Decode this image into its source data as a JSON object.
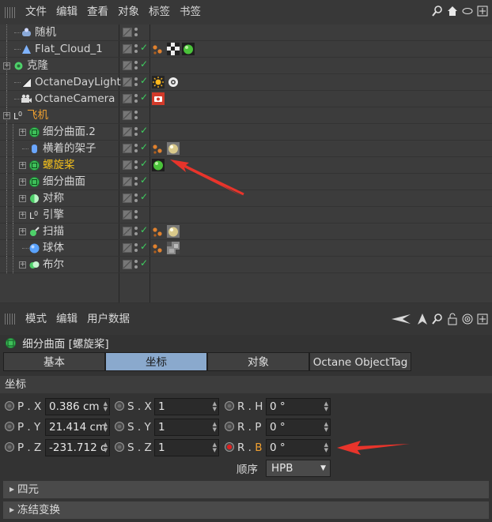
{
  "object_manager": {
    "menu": [
      "文件",
      "编辑",
      "查看",
      "对象",
      "标签",
      "书签"
    ],
    "top_icons": [
      "search-icon",
      "home-icon",
      "eye-icon",
      "add-icon"
    ],
    "rows": [
      {
        "label": "随机",
        "icon": "random-effector-icon",
        "indent": 1,
        "expand": false,
        "color": "normal",
        "tags": []
      },
      {
        "label": "Flat_Cloud_1",
        "icon": "cloud-icon",
        "indent": 1,
        "expand": false,
        "color": "normal",
        "tags": [
          "texture-dots-tag-icon",
          "checker-tag-icon",
          "green-material-tag-icon"
        ]
      },
      {
        "label": "克隆",
        "icon": "cloner-icon",
        "indent": 0,
        "expand": true,
        "color": "normal",
        "tags": []
      },
      {
        "label": "OctaneDayLight",
        "icon": "daylight-icon",
        "indent": 1,
        "expand": false,
        "color": "normal",
        "tags": [
          "sun-tag-icon",
          "gear-tag-icon"
        ]
      },
      {
        "label": "OctaneCamera",
        "icon": "camera-icon",
        "indent": 1,
        "expand": false,
        "color": "normal",
        "tags": [
          "camera-tag-icon"
        ]
      },
      {
        "label": "飞机",
        "icon": "null-object-icon",
        "indent": 0,
        "expand": true,
        "color": "orange",
        "tags": []
      },
      {
        "label": "细分曲面.2",
        "icon": "subdivision-icon",
        "indent": 2,
        "expand": true,
        "color": "normal",
        "tags": []
      },
      {
        "label": "横着的架子",
        "icon": "cylinder-icon",
        "indent": 2,
        "expand": false,
        "color": "normal",
        "tags": [
          "texture-dots-tag-icon",
          "sphere-material-tag-icon"
        ]
      },
      {
        "label": "螺旋桨",
        "icon": "subdivision-icon",
        "indent": 2,
        "expand": true,
        "color": "yellow",
        "tags": [
          "green-material-tag-icon"
        ]
      },
      {
        "label": "细分曲面",
        "icon": "subdivision-icon",
        "indent": 2,
        "expand": true,
        "color": "normal",
        "tags": []
      },
      {
        "label": "对称",
        "icon": "symmetry-icon",
        "indent": 2,
        "expand": true,
        "color": "normal",
        "tags": []
      },
      {
        "label": "引擎",
        "icon": "null-object-icon",
        "indent": 2,
        "expand": true,
        "color": "normal",
        "tags": []
      },
      {
        "label": "扫描",
        "icon": "sweep-icon",
        "indent": 2,
        "expand": true,
        "color": "normal",
        "tags": [
          "texture-dots-tag-icon",
          "sphere-material-tag-icon"
        ]
      },
      {
        "label": "球体",
        "icon": "sphere-icon",
        "indent": 2,
        "expand": false,
        "color": "normal",
        "tags": [
          "texture-dots-tag-icon",
          "noise-material-tag-icon"
        ]
      },
      {
        "label": "布尔",
        "icon": "boolean-icon",
        "indent": 2,
        "expand": true,
        "color": "normal",
        "tags": []
      }
    ]
  },
  "attribute_manager": {
    "menu": [
      "模式",
      "编辑",
      "用户数据"
    ],
    "object_title": "细分曲面 [螺旋桨]",
    "tabs": [
      "基本",
      "坐标",
      "对象",
      "Octane ObjectTag"
    ],
    "active_tab": "坐标",
    "section_title": "坐标",
    "fields": {
      "px": {
        "label": "P . X",
        "value": "0.386 cm"
      },
      "py": {
        "label": "P . Y",
        "value": "21.414 cm"
      },
      "pz": {
        "label": "P . Z",
        "value": "-231.712 c"
      },
      "sx": {
        "label": "S . X",
        "value": "1"
      },
      "sy": {
        "label": "S . Y",
        "value": "1"
      },
      "sz": {
        "label": "S . Z",
        "value": "1"
      },
      "rh": {
        "label": "R . H",
        "value": "0 °"
      },
      "rp": {
        "label": "R . P",
        "value": "0 °"
      },
      "rb": {
        "label": "R . B",
        "value": "0 °"
      }
    },
    "order_label": "顺序",
    "order_value": "HPB",
    "fold_quaternion": "四元",
    "fold_freeze": "冻结变换"
  },
  "colors": {
    "arrow": "#e8342b",
    "active_tab": "#8aa9cd",
    "orange_label": "#f0a030",
    "yellow_label": "#f6c21c"
  }
}
